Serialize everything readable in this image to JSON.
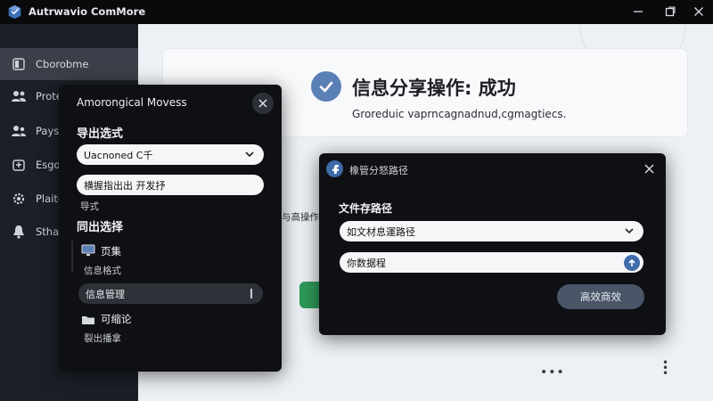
{
  "window": {
    "title": "Autrwavio ComMore",
    "controls": [
      "minimize-icon",
      "maximize-icon",
      "close-icon"
    ]
  },
  "sidebar": {
    "items": [
      {
        "label": "Cborobme",
        "icon": "document-icon",
        "active": true
      },
      {
        "label": "Proté",
        "icon": "users-icon"
      },
      {
        "label": "Pays",
        "icon": "user-group-icon"
      },
      {
        "label": "Esgotr",
        "icon": "export-icon"
      },
      {
        "label": "Plaite",
        "icon": "gear-icon"
      },
      {
        "label": "Sthan",
        "icon": "bell-icon"
      }
    ]
  },
  "main": {
    "success_title": "信息分享操作: 成功",
    "success_subtitle": "Groreduic vaprncagnadnud,cgmagtiecs.",
    "background_fragment": "与高操作"
  },
  "export_dialog": {
    "title": "Amorongical Movess",
    "section1_title": "导出选式",
    "select1_value": "Uacnoned C千",
    "select2_value": "横握指出出 开发抒",
    "format_label": "导式",
    "section2_title": "同出选择",
    "item1_title": "页集",
    "item1_sub": "信息格式",
    "pill_value": "信息管理",
    "item2_title": "可缩论",
    "item2_sub": "裂出播拿"
  },
  "path_dialog": {
    "title": "橡管分怒路径",
    "section_title": "文件存路径",
    "select_value": "如文材息運路径",
    "input_value": "你数据程",
    "primary_button": "高效商效"
  },
  "colors": {
    "accent": "#5b80b6",
    "sidebar_bg": "#1b1f27",
    "dialog_bg": "#0f1013",
    "main_bg": "#edf0f4"
  }
}
